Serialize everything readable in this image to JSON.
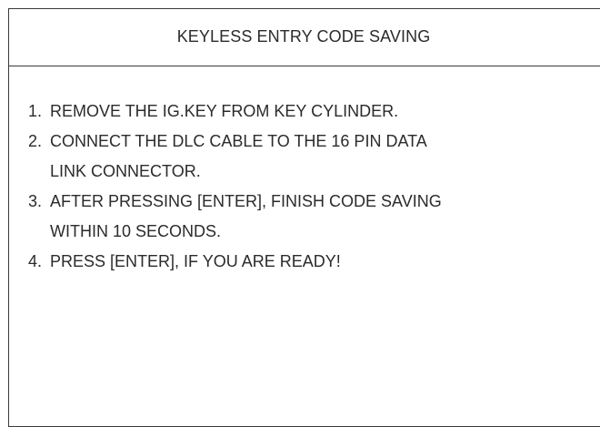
{
  "screen": {
    "title": "KEYLESS ENTRY CODE SAVING"
  },
  "steps": [
    {
      "number": "1.",
      "text": "REMOVE THE IG.KEY FROM KEY CYLINDER."
    },
    {
      "number": "2.",
      "text": "CONNECT THE DLC CABLE TO THE 16 PIN DATA\nLINK CONNECTOR."
    },
    {
      "number": "3.",
      "text": "AFTER PRESSING [ENTER], FINISH CODE SAVING\nWITHIN 10 SECONDS."
    },
    {
      "number": "4.",
      "text": "PRESS [ENTER], IF YOU ARE READY!"
    }
  ]
}
